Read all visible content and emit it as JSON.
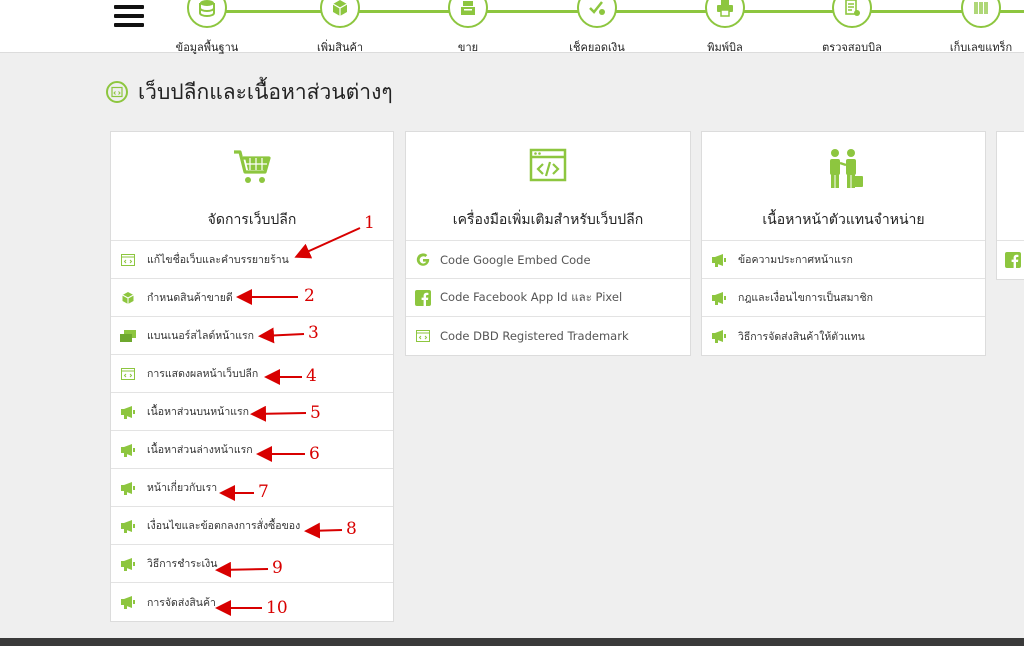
{
  "nav": {
    "steps": [
      {
        "label": "ข้อมูลพื้นฐาน",
        "icon": "database-icon"
      },
      {
        "label": "เพิ่มสินค้า",
        "icon": "box-icon"
      },
      {
        "label": "ขาย",
        "icon": "cash-register-icon"
      },
      {
        "label": "เช็คยอดเงิน",
        "icon": "money-check-icon"
      },
      {
        "label": "พิมพ์บิล",
        "icon": "printer-icon"
      },
      {
        "label": "ตรวจสอบบิล",
        "icon": "receipt-check-icon"
      },
      {
        "label": "เก็บเลขแทร็ก",
        "icon": "barcode-icon"
      }
    ]
  },
  "page": {
    "title": "เว็บปลีกและเนื้อหาส่วนต่างๆ"
  },
  "cards": [
    {
      "title": "จัดการเว็บปลีก",
      "icon": "cart-icon",
      "items": [
        {
          "label": "แก้ไขชื่อเว็บและคำบรรยายร้าน",
          "icon": "code-window-icon"
        },
        {
          "label": "กำหนดสินค้าขายดี",
          "icon": "box-icon"
        },
        {
          "label": "แบนเนอร์สไลด์หน้าแรก",
          "icon": "banner-icon"
        },
        {
          "label": "การแสดงผลหน้าเว็บปลีก",
          "icon": "code-window-icon"
        },
        {
          "label": "เนื้อหาส่วนบนหน้าแรก",
          "icon": "megaphone-icon"
        },
        {
          "label": "เนื้อหาส่วนล่างหน้าแรก",
          "icon": "megaphone-icon"
        },
        {
          "label": "หน้าเกี่ยวกับเรา",
          "icon": "megaphone-icon"
        },
        {
          "label": "เงื่อนไขและข้อตกลงการสั่งซื้อของ",
          "icon": "megaphone-icon"
        },
        {
          "label": "วิธีการชำระเงิน",
          "icon": "megaphone-icon"
        },
        {
          "label": "การจัดส่งสินค้า",
          "icon": "megaphone-icon"
        }
      ]
    },
    {
      "title": "เครื่องมือเพิ่มเติมสำหรับเว็บปลีก",
      "icon": "code-window-icon",
      "items": [
        {
          "label": "Code Google Embed Code",
          "icon": "google-icon"
        },
        {
          "label": "Code Facebook App Id และ Pixel",
          "icon": "facebook-icon"
        },
        {
          "label": "Code DBD Registered Trademark",
          "icon": "code-window-icon"
        }
      ]
    },
    {
      "title": "เนื้อหาหน้าตัวแทนจำหน่าย",
      "icon": "agents-icon",
      "items": [
        {
          "label": "ข้อความประกาศหน้าแรก",
          "icon": "megaphone-icon"
        },
        {
          "label": "กฎและเงื่อนไขการเป็นสมาชิก",
          "icon": "megaphone-icon"
        },
        {
          "label": "วิธีการจัดส่งสินค้าให้ตัวแทน",
          "icon": "megaphone-icon"
        }
      ]
    }
  ],
  "annotations": [
    "1",
    "2",
    "3",
    "4",
    "5",
    "6",
    "7",
    "8",
    "9",
    "10"
  ],
  "colors": {
    "accent": "#8dc63f",
    "annotation": "#d80000"
  }
}
